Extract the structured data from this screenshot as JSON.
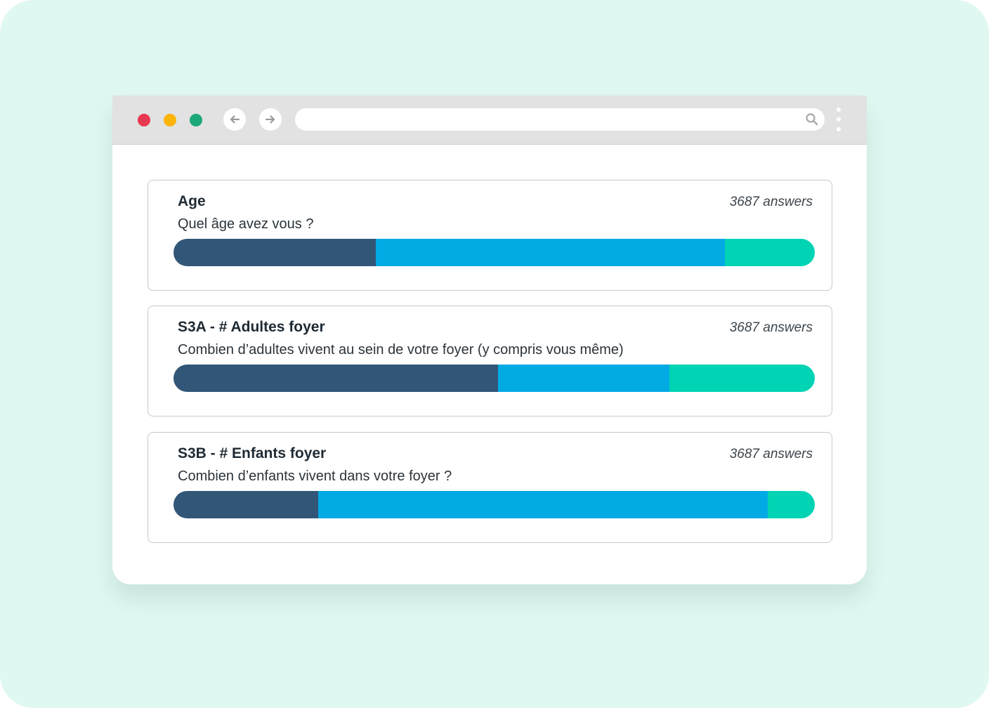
{
  "colors": {
    "background": "#dff8f2",
    "segment_1": "#325677",
    "segment_2": "#02aae4",
    "segment_3": "#00d4b4",
    "close_dot": "#e8384f",
    "minimize_dot": "#fbb40a",
    "maximize_dot": "#1ca878"
  },
  "browser": {
    "url": "",
    "icons": [
      "back-arrow-icon",
      "forward-arrow-icon",
      "search-icon",
      "more-vertical-icon"
    ]
  },
  "cards": [
    {
      "title": "Age",
      "answers": "3687 answers",
      "question": "Quel âge avez vous ?",
      "segments": [
        0.315,
        0.545,
        0.14
      ]
    },
    {
      "title": "S3A - # Adultes foyer",
      "answers": "3687 answers",
      "question": "Combien d’adultes vivent au sein de votre foyer (y compris vous même)",
      "segments": [
        0.506,
        0.267,
        0.227
      ]
    },
    {
      "title": "S3B - # Enfants foyer",
      "answers": "3687 answers",
      "question": "Combien d’enfants vivent dans votre foyer ?",
      "segments": [
        0.226,
        0.701,
        0.073
      ]
    }
  ]
}
